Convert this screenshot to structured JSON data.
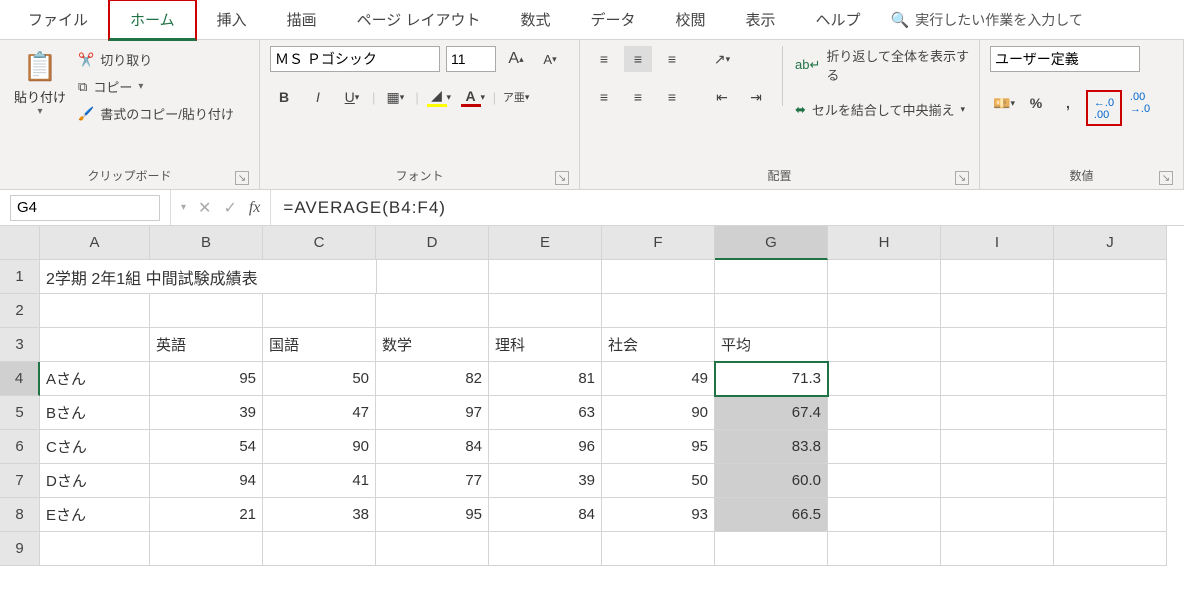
{
  "tabs": {
    "file": "ファイル",
    "home": "ホーム",
    "insert": "挿入",
    "draw": "描画",
    "pageLayout": "ページ レイアウト",
    "formulas": "数式",
    "data": "データ",
    "review": "校閲",
    "view": "表示",
    "help": "ヘルプ"
  },
  "search": {
    "placeholder": "実行したい作業を入力して"
  },
  "ribbon": {
    "clipboard": {
      "paste": "貼り付け",
      "cut": "切り取り",
      "copy": "コピー",
      "formatPainter": "書式のコピー/貼り付け",
      "label": "クリップボード"
    },
    "font": {
      "name": "ＭＳ Ｐゴシック",
      "size": "11",
      "label": "フォント"
    },
    "align": {
      "wrap": "折り返して全体を表示する",
      "merge": "セルを結合して中央揃え",
      "label": "配置"
    },
    "number": {
      "format": "ユーザー定義",
      "label": "数値"
    }
  },
  "fbar": {
    "name": "G4",
    "formula": "=AVERAGE(B4:F4)"
  },
  "cols": [
    "A",
    "B",
    "C",
    "D",
    "E",
    "F",
    "G",
    "H",
    "I",
    "J"
  ],
  "sheet": {
    "title": "2学期 2年1組 中間試験成績表",
    "headers": [
      "英語",
      "国語",
      "数学",
      "理科",
      "社会",
      "平均"
    ],
    "rows": [
      {
        "name": "Aさん",
        "v": [
          "95",
          "50",
          "82",
          "81",
          "49",
          "71.3"
        ]
      },
      {
        "name": "Bさん",
        "v": [
          "39",
          "47",
          "97",
          "63",
          "90",
          "67.4"
        ]
      },
      {
        "name": "Cさん",
        "v": [
          "54",
          "90",
          "84",
          "96",
          "95",
          "83.8"
        ]
      },
      {
        "name": "Dさん",
        "v": [
          "94",
          "41",
          "77",
          "39",
          "50",
          "60.0"
        ]
      },
      {
        "name": "Eさん",
        "v": [
          "21",
          "38",
          "95",
          "84",
          "93",
          "66.5"
        ]
      }
    ]
  },
  "chart_data": {
    "type": "table",
    "title": "2学期 2年1組 中間試験成績表",
    "columns": [
      "英語",
      "国語",
      "数学",
      "理科",
      "社会",
      "平均"
    ],
    "rows": [
      {
        "name": "Aさん",
        "values": [
          95,
          50,
          82,
          81,
          49,
          71.3
        ]
      },
      {
        "name": "Bさん",
        "values": [
          39,
          47,
          97,
          63,
          90,
          67.4
        ]
      },
      {
        "name": "Cさん",
        "values": [
          54,
          90,
          84,
          96,
          95,
          83.8
        ]
      },
      {
        "name": "Dさん",
        "values": [
          94,
          41,
          77,
          39,
          50,
          60.0
        ]
      },
      {
        "name": "Eさん",
        "values": [
          21,
          38,
          95,
          84,
          93,
          66.5
        ]
      }
    ]
  }
}
